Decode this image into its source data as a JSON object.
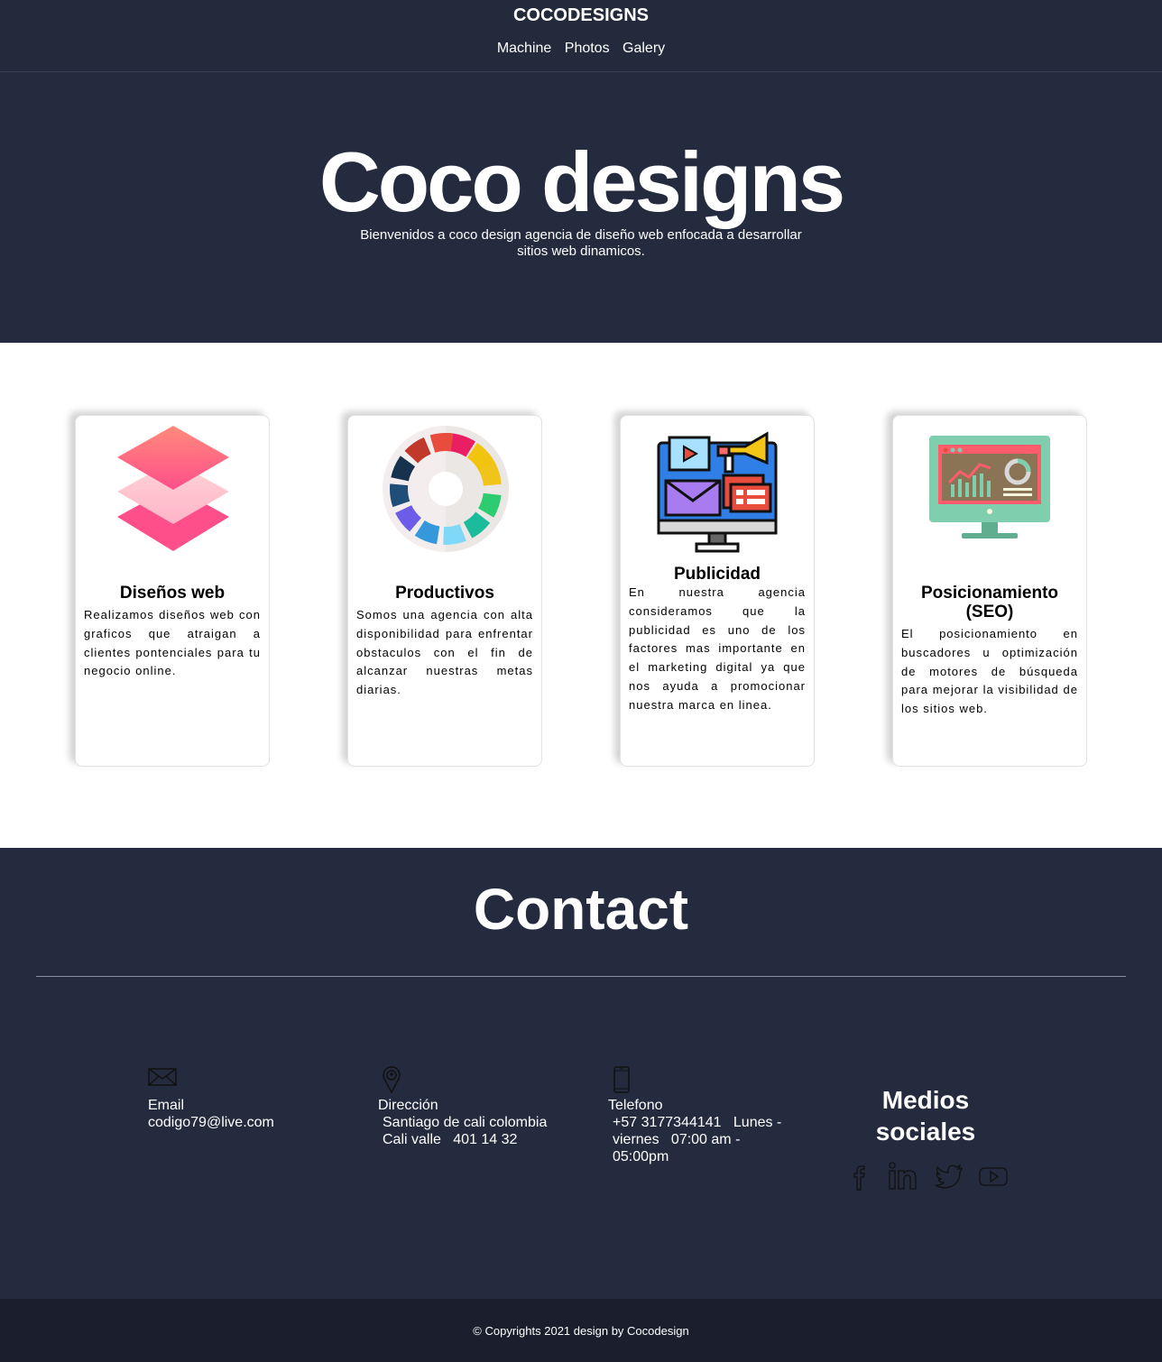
{
  "header": {
    "brand": "COCODESIGNS",
    "nav": [
      "Machine",
      "Photos",
      "Galery"
    ]
  },
  "hero": {
    "title": "Coco designs",
    "subtitle": "Bienvenidos a coco design agencia de diseño web enfocada a desarrollar sitios web dinamicos."
  },
  "services": [
    {
      "icon": "layers-icon",
      "title": "Diseños web",
      "text": "Realizamos diseños web con graficos que atraigan a clientes pontenciales para tu negocio online."
    },
    {
      "icon": "color-wheel-icon",
      "title": "Productivos",
      "text": "Somos una agencia con alta disponibilidad para enfrentar obstaculos con el fin de alcanzar nuestras metas diarias."
    },
    {
      "icon": "digital-marketing-icon",
      "title": "Publicidad",
      "text": "En nuestra agencia consideramos que la publicidad es uno de los factores mas importante en el marketing digital ya que nos ayuda a promocionar nuestra marca en linea."
    },
    {
      "icon": "seo-monitor-icon",
      "title": "Posicionamiento (SEO)",
      "text": "El posicionamiento en buscadores u optimización de motores de búsqueda para mejorar la visibilidad de los sitios web."
    }
  ],
  "contact": {
    "title": "Contact",
    "items": [
      {
        "icon": "envelope-icon",
        "label": "Email",
        "value": "codigo79@live.com"
      },
      {
        "icon": "map-pin-icon",
        "label": "Dirección",
        "value": "Santiago de cali colombia   Cali valle   401 14 32"
      },
      {
        "icon": "smartphone-icon",
        "label": "Telefono",
        "value": "+57 3177344141   Lunes - viernes   07:00 am - 05:00pm"
      }
    ],
    "social": {
      "title": "Medios sociales",
      "icons": [
        "facebook-icon",
        "linkedin-icon",
        "twitter-icon",
        "youtube-icon"
      ]
    }
  },
  "footer": {
    "text": "© Copyrights 2021 design by Cocodesign"
  },
  "colors": {
    "dark_bg": "#252b3e",
    "footer_bg": "#1b1f2d",
    "text_light": "#ffffff"
  }
}
